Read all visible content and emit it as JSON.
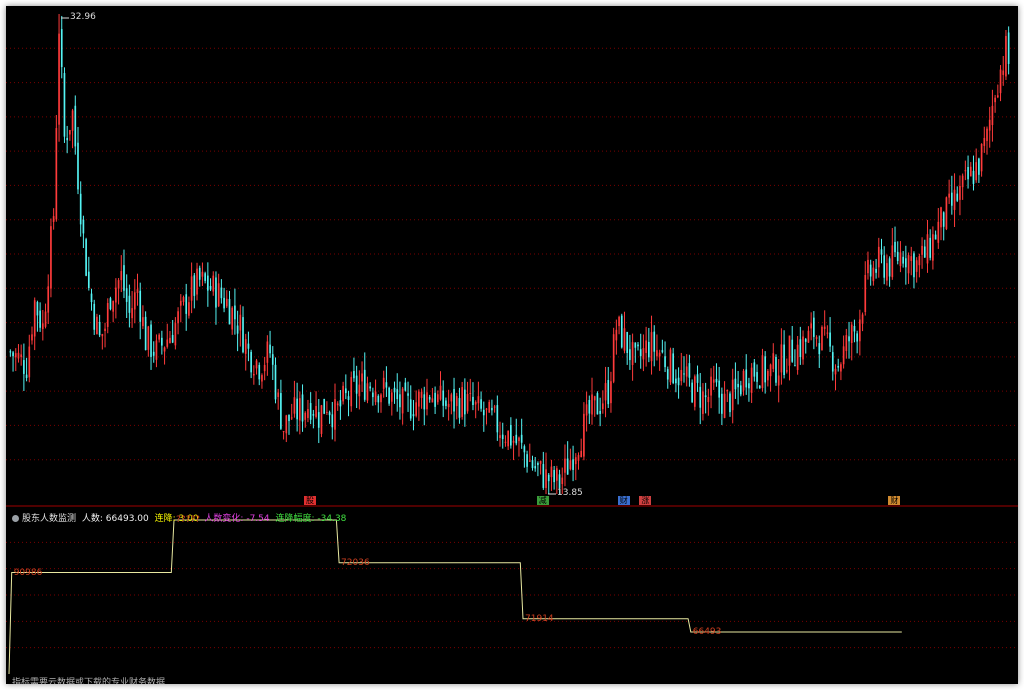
{
  "price_labels": {
    "high": "32.96",
    "low": "13.85"
  },
  "event_tags": [
    {
      "text": "股",
      "color": "#e03030"
    },
    {
      "text": "减",
      "color": "#3a9c3a"
    },
    {
      "text": "财",
      "color": "#3a6fd0"
    },
    {
      "text": "涨",
      "color": "#d04040"
    },
    {
      "text": "财",
      "color": "#d08a30"
    }
  ],
  "indicator": {
    "name": "股东人数监测",
    "fields": [
      {
        "text": "人数: 66493.00",
        "color": "#f0f0f0"
      },
      {
        "text": "连降: 3.00",
        "color": "#f5f500"
      },
      {
        "text": "人数变化: -7.54",
        "color": "#e040e0"
      },
      {
        "text": "连降幅度: -34.38",
        "color": "#40e040"
      }
    ],
    "step_labels": [
      "90986",
      "?????",
      "72036",
      "71914",
      "66493"
    ],
    "footnote": "指标需要云数据或下载的专业财务数据"
  },
  "colors": {
    "up": "#ff3b3b",
    "down": "#54f4f4",
    "step_line": "#e8e8a0",
    "grid": "#7a0000",
    "divider": "#a00000"
  },
  "chart_data": [
    {
      "type": "candlestick",
      "title": "",
      "ylim": [
        13.85,
        32.96
      ],
      "annotations": [
        "32.96",
        "13.85"
      ],
      "path": [
        [
          0,
          19.5
        ],
        [
          6,
          19.0
        ],
        [
          9,
          21.5
        ],
        [
          12,
          20.5
        ],
        [
          16,
          25.0
        ],
        [
          18,
          32.5
        ],
        [
          20,
          28.0
        ],
        [
          23,
          29.0
        ],
        [
          27,
          24.0
        ],
        [
          29,
          22.0
        ],
        [
          33,
          20.0
        ],
        [
          35,
          20.5
        ],
        [
          37,
          21.8
        ],
        [
          41,
          22.5
        ],
        [
          44,
          21.0
        ],
        [
          47,
          22.0
        ],
        [
          50,
          20.0
        ],
        [
          54,
          19.5
        ],
        [
          59,
          20.2
        ],
        [
          63,
          21.0
        ],
        [
          66,
          21.8
        ],
        [
          70,
          22.3
        ],
        [
          75,
          22.0
        ],
        [
          80,
          21.5
        ],
        [
          85,
          20.5
        ],
        [
          88,
          19.5
        ],
        [
          92,
          19.0
        ],
        [
          96,
          19.5
        ],
        [
          99,
          17.5
        ],
        [
          101,
          16.5
        ],
        [
          104,
          17.0
        ],
        [
          108,
          17.2
        ],
        [
          111,
          17.5
        ],
        [
          114,
          17.0
        ],
        [
          117,
          17.5
        ],
        [
          120,
          17.0
        ],
        [
          123,
          17.5
        ],
        [
          127,
          18.0
        ],
        [
          132,
          18.3
        ],
        [
          138,
          18.0
        ],
        [
          142,
          17.6
        ],
        [
          146,
          17.3
        ],
        [
          151,
          17.6
        ],
        [
          155,
          17.9
        ],
        [
          159,
          17.5
        ],
        [
          163,
          17.4
        ],
        [
          167,
          17.6
        ],
        [
          171,
          17.3
        ],
        [
          175,
          17.0
        ],
        [
          179,
          16.7
        ],
        [
          183,
          16.3
        ],
        [
          188,
          15.8
        ],
        [
          193,
          15.0
        ],
        [
          198,
          14.5
        ],
        [
          203,
          14.3
        ],
        [
          206,
          15.0
        ],
        [
          210,
          16.0
        ],
        [
          214,
          17.0
        ],
        [
          218,
          17.5
        ],
        [
          221,
          18.0
        ],
        [
          224,
          20.5
        ],
        [
          227,
          20.0
        ],
        [
          231,
          19.0
        ],
        [
          236,
          19.8
        ],
        [
          240,
          19.5
        ],
        [
          245,
          18.8
        ],
        [
          249,
          18.4
        ],
        [
          253,
          18.0
        ],
        [
          257,
          17.6
        ],
        [
          260,
          18.0
        ],
        [
          264,
          17.5
        ],
        [
          268,
          17.8
        ],
        [
          272,
          18.7
        ],
        [
          276,
          18.8
        ],
        [
          280,
          18.6
        ],
        [
          284,
          19.0
        ],
        [
          288,
          19.5
        ],
        [
          293,
          19.8
        ],
        [
          297,
          20.3
        ],
        [
          300,
          20.0
        ],
        [
          303,
          19.5
        ],
        [
          306,
          19.0
        ],
        [
          310,
          20.0
        ],
        [
          313,
          20.5
        ],
        [
          317,
          22.5
        ],
        [
          321,
          23.0
        ],
        [
          325,
          23.0
        ],
        [
          330,
          23.5
        ],
        [
          335,
          23.0
        ],
        [
          339,
          23.5
        ],
        [
          343,
          24.5
        ],
        [
          346,
          25.0
        ],
        [
          349,
          25.5
        ],
        [
          352,
          26.0
        ],
        [
          355,
          26.5
        ],
        [
          358,
          27.0
        ],
        [
          361,
          28.0
        ],
        [
          364,
          30.0
        ],
        [
          368,
          31.5
        ],
        [
          369,
          31.0
        ]
      ]
    },
    {
      "type": "step",
      "series": [
        {
          "values": [
            [
              0,
              90986
            ],
            [
              1,
              90986
            ],
            [
              60,
              90986
            ],
            [
              61,
              112637
            ],
            [
              121,
              112637
            ],
            [
              122,
              95036
            ],
            [
              189,
              95036
            ],
            [
              190,
              71914
            ],
            [
              251,
              71914
            ],
            [
              252,
              66493
            ],
            [
              330,
              66493
            ]
          ]
        }
      ],
      "ylim": [
        50000,
        112637
      ]
    }
  ]
}
